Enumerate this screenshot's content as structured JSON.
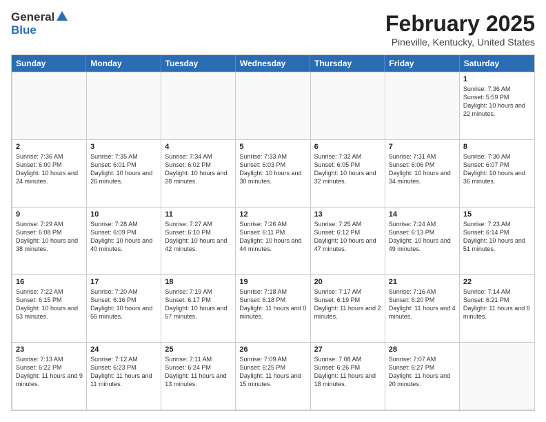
{
  "header": {
    "logo_general": "General",
    "logo_blue": "Blue",
    "title": "February 2025",
    "subtitle": "Pineville, Kentucky, United States"
  },
  "weekdays": [
    "Sunday",
    "Monday",
    "Tuesday",
    "Wednesday",
    "Thursday",
    "Friday",
    "Saturday"
  ],
  "rows": [
    [
      {
        "day": "",
        "text": ""
      },
      {
        "day": "",
        "text": ""
      },
      {
        "day": "",
        "text": ""
      },
      {
        "day": "",
        "text": ""
      },
      {
        "day": "",
        "text": ""
      },
      {
        "day": "",
        "text": ""
      },
      {
        "day": "1",
        "text": "Sunrise: 7:36 AM\nSunset: 5:59 PM\nDaylight: 10 hours and 22 minutes."
      }
    ],
    [
      {
        "day": "2",
        "text": "Sunrise: 7:36 AM\nSunset: 6:00 PM\nDaylight: 10 hours and 24 minutes."
      },
      {
        "day": "3",
        "text": "Sunrise: 7:35 AM\nSunset: 6:01 PM\nDaylight: 10 hours and 26 minutes."
      },
      {
        "day": "4",
        "text": "Sunrise: 7:34 AM\nSunset: 6:02 PM\nDaylight: 10 hours and 28 minutes."
      },
      {
        "day": "5",
        "text": "Sunrise: 7:33 AM\nSunset: 6:03 PM\nDaylight: 10 hours and 30 minutes."
      },
      {
        "day": "6",
        "text": "Sunrise: 7:32 AM\nSunset: 6:05 PM\nDaylight: 10 hours and 32 minutes."
      },
      {
        "day": "7",
        "text": "Sunrise: 7:31 AM\nSunset: 6:06 PM\nDaylight: 10 hours and 34 minutes."
      },
      {
        "day": "8",
        "text": "Sunrise: 7:30 AM\nSunset: 6:07 PM\nDaylight: 10 hours and 36 minutes."
      }
    ],
    [
      {
        "day": "9",
        "text": "Sunrise: 7:29 AM\nSunset: 6:08 PM\nDaylight: 10 hours and 38 minutes."
      },
      {
        "day": "10",
        "text": "Sunrise: 7:28 AM\nSunset: 6:09 PM\nDaylight: 10 hours and 40 minutes."
      },
      {
        "day": "11",
        "text": "Sunrise: 7:27 AM\nSunset: 6:10 PM\nDaylight: 10 hours and 42 minutes."
      },
      {
        "day": "12",
        "text": "Sunrise: 7:26 AM\nSunset: 6:11 PM\nDaylight: 10 hours and 44 minutes."
      },
      {
        "day": "13",
        "text": "Sunrise: 7:25 AM\nSunset: 6:12 PM\nDaylight: 10 hours and 47 minutes."
      },
      {
        "day": "14",
        "text": "Sunrise: 7:24 AM\nSunset: 6:13 PM\nDaylight: 10 hours and 49 minutes."
      },
      {
        "day": "15",
        "text": "Sunrise: 7:23 AM\nSunset: 6:14 PM\nDaylight: 10 hours and 51 minutes."
      }
    ],
    [
      {
        "day": "16",
        "text": "Sunrise: 7:22 AM\nSunset: 6:15 PM\nDaylight: 10 hours and 53 minutes."
      },
      {
        "day": "17",
        "text": "Sunrise: 7:20 AM\nSunset: 6:16 PM\nDaylight: 10 hours and 55 minutes."
      },
      {
        "day": "18",
        "text": "Sunrise: 7:19 AM\nSunset: 6:17 PM\nDaylight: 10 hours and 57 minutes."
      },
      {
        "day": "19",
        "text": "Sunrise: 7:18 AM\nSunset: 6:18 PM\nDaylight: 11 hours and 0 minutes."
      },
      {
        "day": "20",
        "text": "Sunrise: 7:17 AM\nSunset: 6:19 PM\nDaylight: 11 hours and 2 minutes."
      },
      {
        "day": "21",
        "text": "Sunrise: 7:16 AM\nSunset: 6:20 PM\nDaylight: 11 hours and 4 minutes."
      },
      {
        "day": "22",
        "text": "Sunrise: 7:14 AM\nSunset: 6:21 PM\nDaylight: 11 hours and 6 minutes."
      }
    ],
    [
      {
        "day": "23",
        "text": "Sunrise: 7:13 AM\nSunset: 6:22 PM\nDaylight: 11 hours and 9 minutes."
      },
      {
        "day": "24",
        "text": "Sunrise: 7:12 AM\nSunset: 6:23 PM\nDaylight: 11 hours and 11 minutes."
      },
      {
        "day": "25",
        "text": "Sunrise: 7:11 AM\nSunset: 6:24 PM\nDaylight: 11 hours and 13 minutes."
      },
      {
        "day": "26",
        "text": "Sunrise: 7:09 AM\nSunset: 6:25 PM\nDaylight: 11 hours and 15 minutes."
      },
      {
        "day": "27",
        "text": "Sunrise: 7:08 AM\nSunset: 6:26 PM\nDaylight: 11 hours and 18 minutes."
      },
      {
        "day": "28",
        "text": "Sunrise: 7:07 AM\nSunset: 6:27 PM\nDaylight: 11 hours and 20 minutes."
      },
      {
        "day": "",
        "text": ""
      }
    ]
  ]
}
